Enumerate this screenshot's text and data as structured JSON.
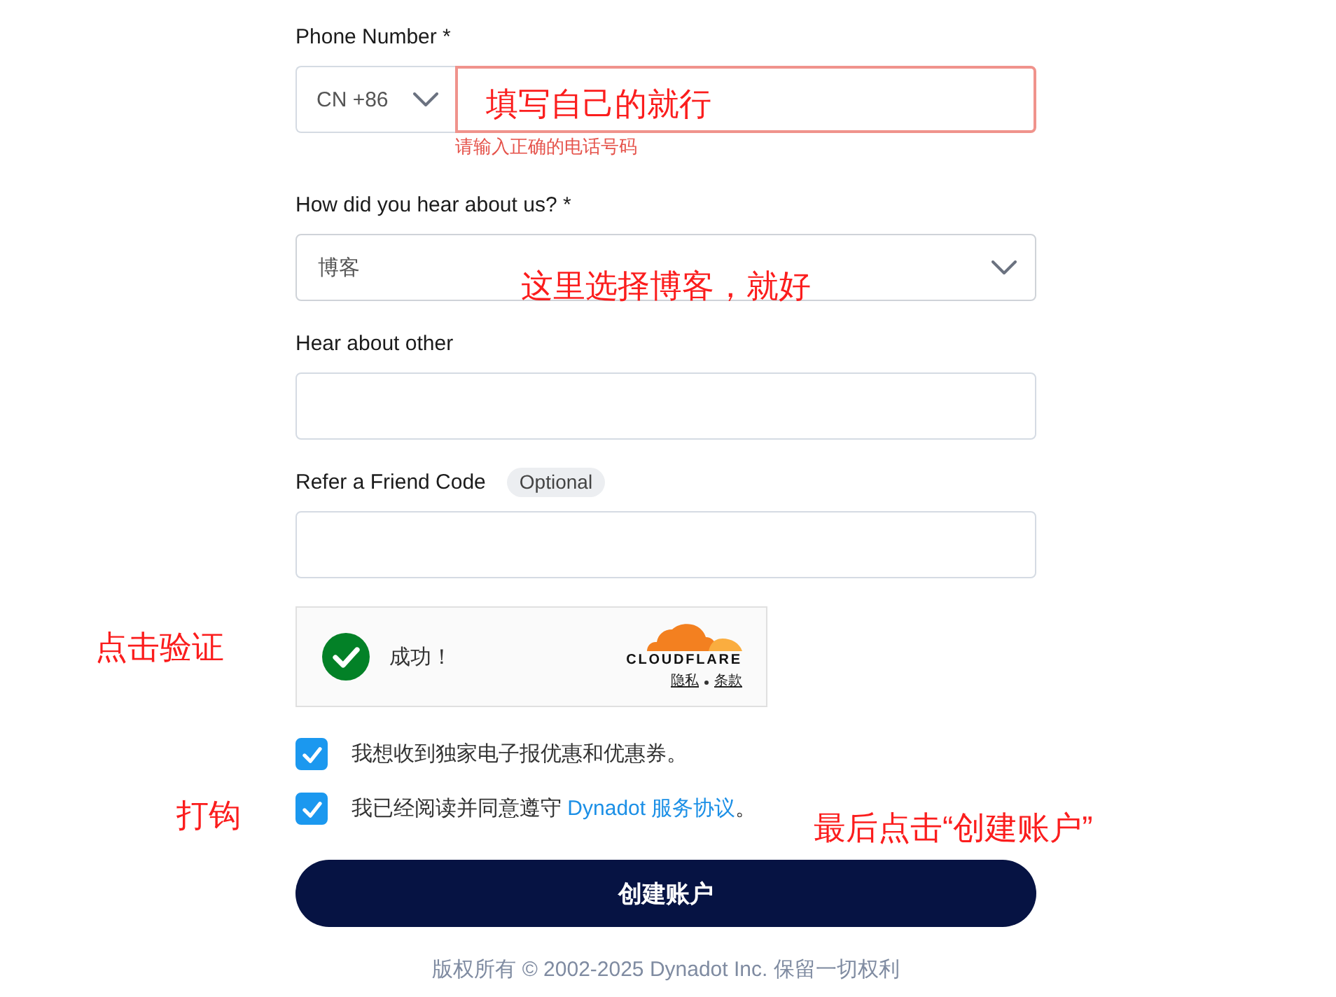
{
  "fields": [
    {
      "kind": "phone",
      "label": "Phone Number *",
      "country_code": "CN +86",
      "invalid": true,
      "error": "请输入正确的电话号码"
    },
    {
      "kind": "select",
      "label": "How did you hear about us? *",
      "value": "博客"
    },
    {
      "kind": "text",
      "label": "Hear about other"
    },
    {
      "kind": "text",
      "label": "Refer a Friend Code",
      "badge": "Optional"
    }
  ],
  "captcha": {
    "verified": true,
    "status": "成功！",
    "brand": "CLOUDFLARE",
    "links": [
      "隐私",
      "条款"
    ]
  },
  "checkboxes": [
    {
      "text": "我想收到独家电子报优惠和优惠券。",
      "checked": true
    },
    {
      "text": "我已经阅读并同意遵守 ",
      "link": "Dynadot 服务协议",
      "suffix": "。",
      "checked": true
    }
  ],
  "submit_button": "创建账户",
  "footer": "版权所有 © 2002-2025 Dynadot Inc. 保留一切权利",
  "annotations": [
    "填写自己的就行",
    "这里选择博客，就好",
    "点击验证",
    "打钩",
    "最后点击“创建账户”"
  ]
}
